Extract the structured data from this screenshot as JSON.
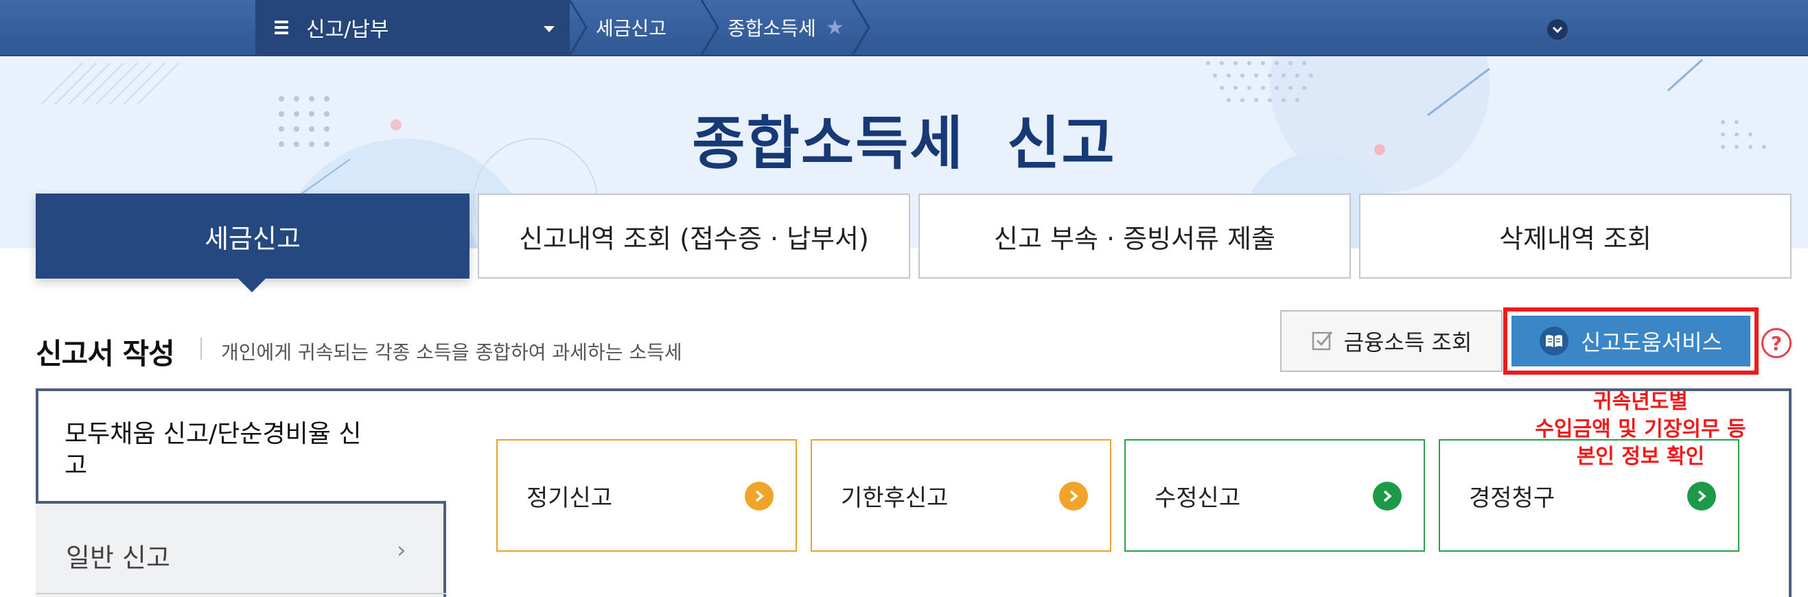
{
  "topbar": {
    "menu_label": "신고/납부",
    "breadcrumbs": [
      "세금신고",
      "종합소득세"
    ],
    "icons": [
      "hamburger-icon",
      "caret-down-icon",
      "star-icon",
      "chevron-down-icon"
    ]
  },
  "hero": {
    "title": "종합소득세  신고"
  },
  "tabs": [
    {
      "label": "세금신고",
      "active": true
    },
    {
      "label": "신고내역 조회 (접수증 · 납부서)",
      "active": false
    },
    {
      "label": "신고 부속 · 증빙서류 제출",
      "active": false
    },
    {
      "label": "삭제내역 조회",
      "active": false
    }
  ],
  "section": {
    "title": "신고서 작성",
    "description": "개인에게 귀속되는 각종 소득을 종합하여 과세하는 소득세"
  },
  "buttons": {
    "finance_lookup": "금융소득 조회",
    "help_service": "신고도움서비스",
    "help_question": "?"
  },
  "sidebar": {
    "items": [
      {
        "label": "모두채움 신고/단순경비율 신고",
        "active": true
      },
      {
        "label": "일반 신고",
        "active": false
      }
    ]
  },
  "cards": [
    {
      "label": "정기신고",
      "color": "#f0a52a"
    },
    {
      "label": "기한후신고",
      "color": "#f0a52a"
    },
    {
      "label": "수정신고",
      "color": "#1c9a47"
    },
    {
      "label": "경정청구",
      "color": "#1c9a47"
    }
  ],
  "annotation": {
    "lines": [
      "귀속년도별",
      "수입금액 및 기장의무 등",
      "본인 정보 확인"
    ],
    "color": "#f01a1a"
  },
  "colors": {
    "navy": "#24487f",
    "accent_blue": "#3b86c6",
    "highlight_red": "#f01a1a"
  }
}
